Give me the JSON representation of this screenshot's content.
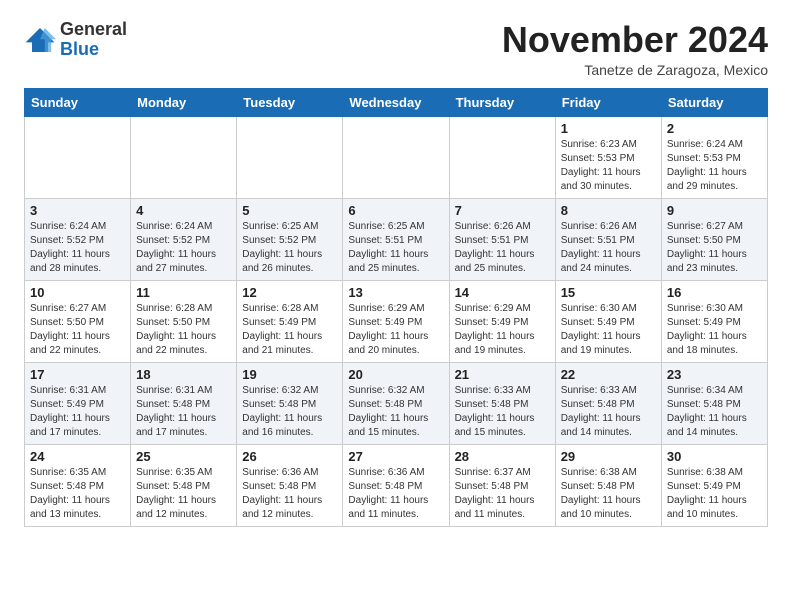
{
  "header": {
    "logo_general": "General",
    "logo_blue": "Blue",
    "month": "November 2024",
    "location": "Tanetze de Zaragoza, Mexico"
  },
  "weekdays": [
    "Sunday",
    "Monday",
    "Tuesday",
    "Wednesday",
    "Thursday",
    "Friday",
    "Saturday"
  ],
  "weeks": [
    [
      {
        "day": "",
        "info": ""
      },
      {
        "day": "",
        "info": ""
      },
      {
        "day": "",
        "info": ""
      },
      {
        "day": "",
        "info": ""
      },
      {
        "day": "",
        "info": ""
      },
      {
        "day": "1",
        "info": "Sunrise: 6:23 AM\nSunset: 5:53 PM\nDaylight: 11 hours\nand 30 minutes."
      },
      {
        "day": "2",
        "info": "Sunrise: 6:24 AM\nSunset: 5:53 PM\nDaylight: 11 hours\nand 29 minutes."
      }
    ],
    [
      {
        "day": "3",
        "info": "Sunrise: 6:24 AM\nSunset: 5:52 PM\nDaylight: 11 hours\nand 28 minutes."
      },
      {
        "day": "4",
        "info": "Sunrise: 6:24 AM\nSunset: 5:52 PM\nDaylight: 11 hours\nand 27 minutes."
      },
      {
        "day": "5",
        "info": "Sunrise: 6:25 AM\nSunset: 5:52 PM\nDaylight: 11 hours\nand 26 minutes."
      },
      {
        "day": "6",
        "info": "Sunrise: 6:25 AM\nSunset: 5:51 PM\nDaylight: 11 hours\nand 25 minutes."
      },
      {
        "day": "7",
        "info": "Sunrise: 6:26 AM\nSunset: 5:51 PM\nDaylight: 11 hours\nand 25 minutes."
      },
      {
        "day": "8",
        "info": "Sunrise: 6:26 AM\nSunset: 5:51 PM\nDaylight: 11 hours\nand 24 minutes."
      },
      {
        "day": "9",
        "info": "Sunrise: 6:27 AM\nSunset: 5:50 PM\nDaylight: 11 hours\nand 23 minutes."
      }
    ],
    [
      {
        "day": "10",
        "info": "Sunrise: 6:27 AM\nSunset: 5:50 PM\nDaylight: 11 hours\nand 22 minutes."
      },
      {
        "day": "11",
        "info": "Sunrise: 6:28 AM\nSunset: 5:50 PM\nDaylight: 11 hours\nand 22 minutes."
      },
      {
        "day": "12",
        "info": "Sunrise: 6:28 AM\nSunset: 5:49 PM\nDaylight: 11 hours\nand 21 minutes."
      },
      {
        "day": "13",
        "info": "Sunrise: 6:29 AM\nSunset: 5:49 PM\nDaylight: 11 hours\nand 20 minutes."
      },
      {
        "day": "14",
        "info": "Sunrise: 6:29 AM\nSunset: 5:49 PM\nDaylight: 11 hours\nand 19 minutes."
      },
      {
        "day": "15",
        "info": "Sunrise: 6:30 AM\nSunset: 5:49 PM\nDaylight: 11 hours\nand 19 minutes."
      },
      {
        "day": "16",
        "info": "Sunrise: 6:30 AM\nSunset: 5:49 PM\nDaylight: 11 hours\nand 18 minutes."
      }
    ],
    [
      {
        "day": "17",
        "info": "Sunrise: 6:31 AM\nSunset: 5:49 PM\nDaylight: 11 hours\nand 17 minutes."
      },
      {
        "day": "18",
        "info": "Sunrise: 6:31 AM\nSunset: 5:48 PM\nDaylight: 11 hours\nand 17 minutes."
      },
      {
        "day": "19",
        "info": "Sunrise: 6:32 AM\nSunset: 5:48 PM\nDaylight: 11 hours\nand 16 minutes."
      },
      {
        "day": "20",
        "info": "Sunrise: 6:32 AM\nSunset: 5:48 PM\nDaylight: 11 hours\nand 15 minutes."
      },
      {
        "day": "21",
        "info": "Sunrise: 6:33 AM\nSunset: 5:48 PM\nDaylight: 11 hours\nand 15 minutes."
      },
      {
        "day": "22",
        "info": "Sunrise: 6:33 AM\nSunset: 5:48 PM\nDaylight: 11 hours\nand 14 minutes."
      },
      {
        "day": "23",
        "info": "Sunrise: 6:34 AM\nSunset: 5:48 PM\nDaylight: 11 hours\nand 14 minutes."
      }
    ],
    [
      {
        "day": "24",
        "info": "Sunrise: 6:35 AM\nSunset: 5:48 PM\nDaylight: 11 hours\nand 13 minutes."
      },
      {
        "day": "25",
        "info": "Sunrise: 6:35 AM\nSunset: 5:48 PM\nDaylight: 11 hours\nand 12 minutes."
      },
      {
        "day": "26",
        "info": "Sunrise: 6:36 AM\nSunset: 5:48 PM\nDaylight: 11 hours\nand 12 minutes."
      },
      {
        "day": "27",
        "info": "Sunrise: 6:36 AM\nSunset: 5:48 PM\nDaylight: 11 hours\nand 11 minutes."
      },
      {
        "day": "28",
        "info": "Sunrise: 6:37 AM\nSunset: 5:48 PM\nDaylight: 11 hours\nand 11 minutes."
      },
      {
        "day": "29",
        "info": "Sunrise: 6:38 AM\nSunset: 5:48 PM\nDaylight: 11 hours\nand 10 minutes."
      },
      {
        "day": "30",
        "info": "Sunrise: 6:38 AM\nSunset: 5:49 PM\nDaylight: 11 hours\nand 10 minutes."
      }
    ]
  ]
}
